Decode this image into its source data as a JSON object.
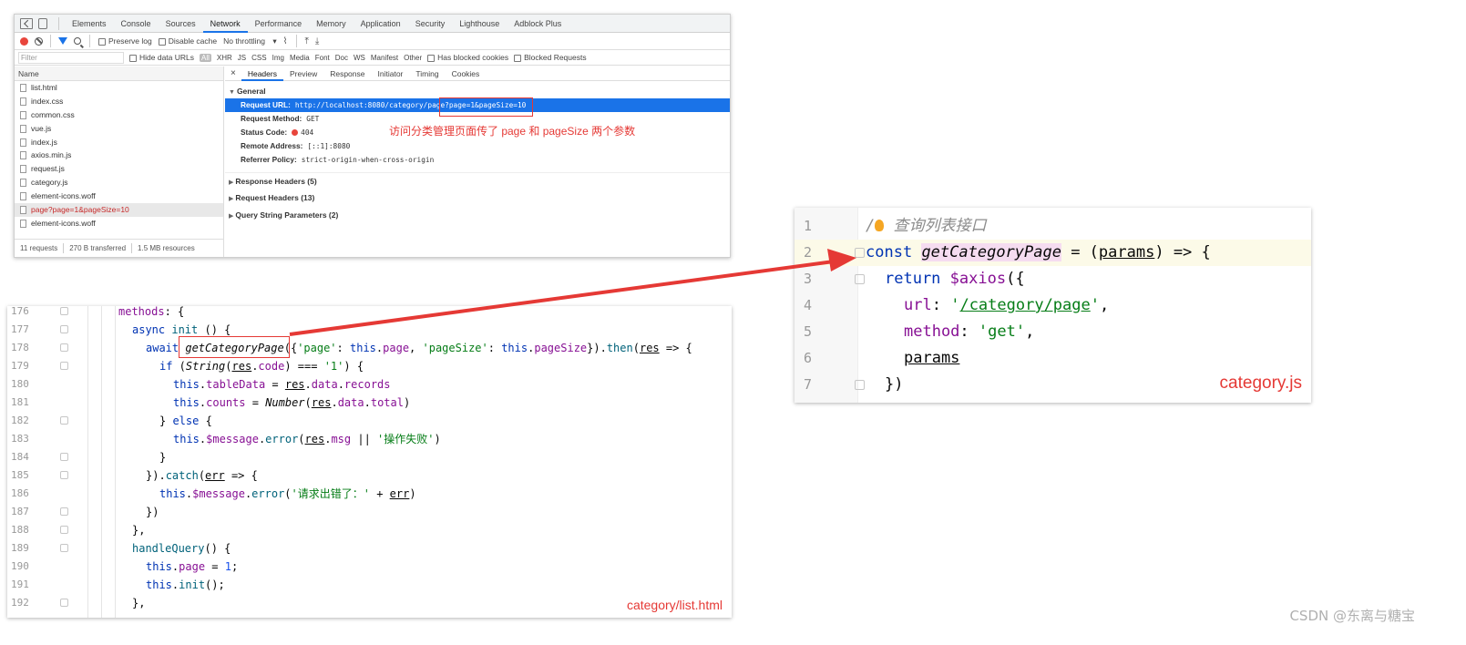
{
  "devtools": {
    "tabs": [
      "Elements",
      "Console",
      "Sources",
      "Network",
      "Performance",
      "Memory",
      "Application",
      "Security",
      "Lighthouse",
      "Adblock Plus"
    ],
    "active_tab": "Network",
    "toolbar": {
      "preserve_log": "Preserve log",
      "disable_cache": "Disable cache",
      "throttling": "No throttling"
    },
    "filter": {
      "placeholder": "Filter",
      "hide_data_urls": "Hide data URLs",
      "all": "All",
      "types": [
        "XHR",
        "JS",
        "CSS",
        "Img",
        "Media",
        "Font",
        "Doc",
        "WS",
        "Manifest",
        "Other"
      ],
      "has_blocked_cookies": "Has blocked cookies",
      "blocked_requests": "Blocked Requests"
    },
    "requests_header": "Name",
    "requests": [
      "list.html",
      "index.css",
      "common.css",
      "vue.js",
      "index.js",
      "axios.min.js",
      "request.js",
      "category.js",
      "element-icons.woff",
      "page?page=1&pageSize=10",
      "element-icons.woff"
    ],
    "selected_request_index": 9,
    "status_bar": {
      "requests": "11 requests",
      "transferred": "270 B transferred",
      "resources": "1.5 MB resources"
    },
    "detail_tabs": [
      "Headers",
      "Preview",
      "Response",
      "Initiator",
      "Timing",
      "Cookies"
    ],
    "active_detail_tab": "Headers",
    "general": {
      "title": "General",
      "request_url_label": "Request URL:",
      "request_url": "http://localhost:8080/category/page?page=1&pageSize=10",
      "method_label": "Request Method:",
      "method": "GET",
      "status_label": "Status Code:",
      "status": "404",
      "remote_label": "Remote Address:",
      "remote": "[::1]:8080",
      "referrer_label": "Referrer Policy:",
      "referrer": "strict-origin-when-cross-origin"
    },
    "annotation": "访问分类管理页面传了 page 和 pageSize 两个参数",
    "sections": [
      "Response Headers (5)",
      "Request Headers (13)",
      "Query String Parameters (2)"
    ]
  },
  "list_editor": {
    "caption": "category/list.html",
    "line_numbers": [
      "176",
      "177",
      "178",
      "179",
      "180",
      "181",
      "182",
      "183",
      "184",
      "185",
      "186",
      "187",
      "188",
      "189",
      "190",
      "191",
      "192"
    ]
  },
  "category_editor": {
    "caption": "category.js",
    "line_numbers": [
      "1",
      "2",
      "3",
      "4",
      "5",
      "6",
      "7"
    ],
    "comment": "查询列表接口"
  },
  "watermark": "CSDN @东离与糖宝",
  "colors": {
    "accent": "#1a73e8",
    "annotation": "#e53935"
  }
}
